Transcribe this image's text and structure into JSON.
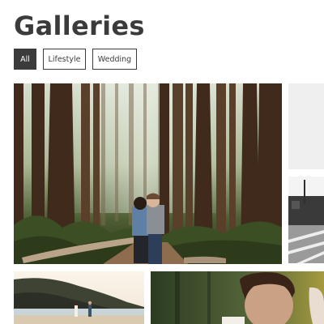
{
  "header": {
    "title": "Galleries"
  },
  "filters": {
    "items": [
      {
        "label": "All",
        "active": true
      },
      {
        "label": "Lifestyle",
        "active": false
      },
      {
        "label": "Wedding",
        "active": false
      }
    ]
  },
  "gallery": {
    "photos": [
      {
        "name": "forest-couple-photo"
      },
      {
        "name": "side-placeholder-photo"
      },
      {
        "name": "street-photo"
      },
      {
        "name": "beach-couple-photo"
      },
      {
        "name": "man-portrait-photo"
      }
    ]
  },
  "colors": {
    "accent": "#3b3b3b",
    "background": "#ffffff"
  }
}
